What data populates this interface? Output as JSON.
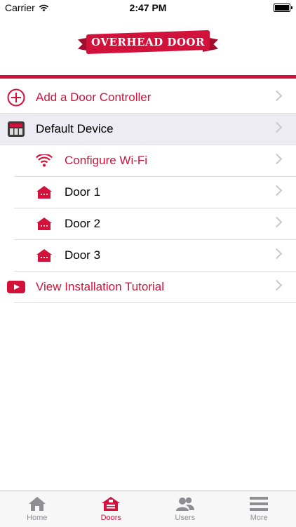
{
  "status_bar": {
    "carrier": "Carrier",
    "time": "2:47 PM"
  },
  "logo": {
    "text": "OVERHEAD DOOR"
  },
  "colors": {
    "brand": "#d3123c",
    "inactive": "#8e8e93",
    "divider": "#dcdce0"
  },
  "list": [
    {
      "label": "Add a Door Controller",
      "icon": "plus-circle-icon",
      "style": "red"
    },
    {
      "label": "Default Device",
      "icon": "controller-device-icon",
      "style": "black",
      "highlighted": true
    },
    {
      "label": "Configure Wi-Fi",
      "icon": "wifi-icon",
      "style": "red"
    },
    {
      "label": "Door 1",
      "icon": "garage-icon",
      "style": "black"
    },
    {
      "label": "Door 2",
      "icon": "garage-icon",
      "style": "black"
    },
    {
      "label": "Door 3",
      "icon": "garage-icon",
      "style": "black"
    },
    {
      "label": "View Installation Tutorial",
      "icon": "youtube-play-icon",
      "style": "red"
    }
  ],
  "tabs": [
    {
      "label": "Home",
      "icon": "home-icon",
      "active": false
    },
    {
      "label": "Doors",
      "icon": "garage-icon",
      "active": true
    },
    {
      "label": "Users",
      "icon": "users-icon",
      "active": false
    },
    {
      "label": "More",
      "icon": "menu-icon",
      "active": false
    }
  ]
}
